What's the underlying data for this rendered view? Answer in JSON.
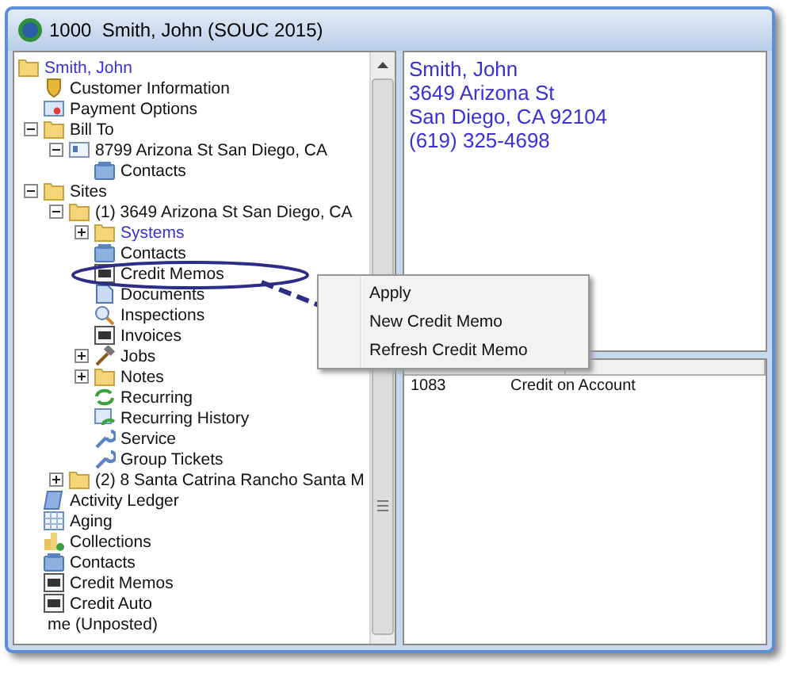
{
  "window": {
    "title": "1000  Smith, John (SOUC 2015)"
  },
  "tree": {
    "items": [
      {
        "label": "Smith, John",
        "kind": "folder",
        "emphasized": true,
        "children": [
          {
            "label": "Customer Information",
            "kind": "shield",
            "emphasized": false
          },
          {
            "label": "Payment Options",
            "kind": "card",
            "emphasized": false
          },
          {
            "label": "Bill To",
            "kind": "folder",
            "emphasized": false,
            "expanded": true,
            "children": [
              {
                "label": "8799 Arizona St San Diego, CA",
                "kind": "address",
                "emphasized": false,
                "expanded": true,
                "children": [
                  {
                    "label": "Contacts",
                    "kind": "contacts",
                    "emphasized": false
                  }
                ]
              }
            ]
          },
          {
            "label": "Sites",
            "kind": "folder",
            "emphasized": false,
            "expanded": true,
            "children": [
              {
                "label": "(1) 3649 Arizona St San Diego, CA",
                "kind": "folder",
                "emphasized": false,
                "expanded": true,
                "children": [
                  {
                    "label": "Systems",
                    "kind": "folder",
                    "emphasized": true,
                    "expanded": false
                  },
                  {
                    "label": "Contacts",
                    "kind": "contacts",
                    "emphasized": false
                  },
                  {
                    "label": "Credit Memos",
                    "kind": "memo",
                    "emphasized": false
                  },
                  {
                    "label": "Documents",
                    "kind": "document",
                    "emphasized": false
                  },
                  {
                    "label": "Inspections",
                    "kind": "search",
                    "emphasized": false
                  },
                  {
                    "label": "Invoices",
                    "kind": "memo",
                    "emphasized": false
                  },
                  {
                    "label": "Jobs",
                    "kind": "hammer",
                    "emphasized": false,
                    "expanded": false
                  },
                  {
                    "label": "Notes",
                    "kind": "folder",
                    "emphasized": false,
                    "expanded": false
                  },
                  {
                    "label": "Recurring",
                    "kind": "refresh",
                    "emphasized": false
                  },
                  {
                    "label": "Recurring History",
                    "kind": "history",
                    "emphasized": false
                  },
                  {
                    "label": "Service",
                    "kind": "wrench",
                    "emphasized": false
                  },
                  {
                    "label": "Group Tickets",
                    "kind": "wrench",
                    "emphasized": false
                  }
                ]
              },
              {
                "label": "(2) 8 Santa Catrina Rancho Santa M",
                "kind": "folder",
                "emphasized": false,
                "expanded": false
              }
            ]
          },
          {
            "label": "Activity Ledger",
            "kind": "ledger",
            "emphasized": false
          },
          {
            "label": "Aging",
            "kind": "grid",
            "emphasized": false
          },
          {
            "label": "Collections",
            "kind": "chart",
            "emphasized": false
          },
          {
            "label": "Contacts",
            "kind": "contacts",
            "emphasized": false
          },
          {
            "label": "Credit Memos",
            "kind": "memo",
            "emphasized": false
          },
          {
            "label": "Credit Auto",
            "kind": "memo",
            "emphasized": false
          },
          {
            "label": "me (Unposted)",
            "kind": "none",
            "emphasized": false
          }
        ]
      }
    ]
  },
  "customer_card": {
    "lines": [
      "Smith, John",
      "3649 Arizona St",
      "San Diego, CA 92104",
      "(619) 325-4698"
    ]
  },
  "list": {
    "rows": [
      {
        "cells": [
          "1083",
          "Credit on Account"
        ]
      }
    ]
  },
  "context_menu": {
    "items": [
      {
        "label": "Apply"
      },
      {
        "label": "New Credit Memo"
      },
      {
        "label": "Refresh Credit Memo"
      }
    ]
  }
}
